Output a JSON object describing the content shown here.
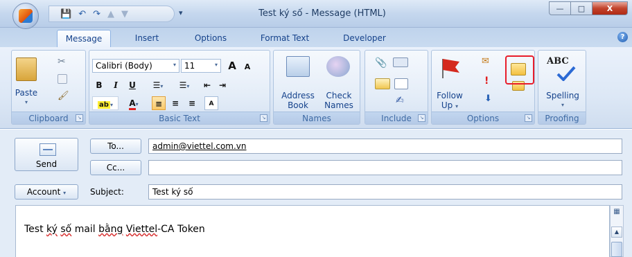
{
  "window": {
    "title": "Test ký số - Message (HTML)",
    "controls": [
      "—",
      "□",
      "X"
    ]
  },
  "qat": {
    "save_icon": "save-icon",
    "undo_icon": "undo-icon",
    "redo_icon": "redo-icon",
    "up_icon": "up-arrow-icon",
    "down_icon": "down-arrow-icon",
    "more": "▾"
  },
  "tabs": [
    "Message",
    "Insert",
    "Options",
    "Format Text",
    "Developer"
  ],
  "help": "?",
  "ribbon": {
    "clipboard": {
      "label": "Clipboard",
      "paste": "Paste"
    },
    "basic_text": {
      "label": "Basic Text",
      "font": "Calibri (Body)",
      "size": "11",
      "grow": "A",
      "shrink": "A",
      "bold": "B",
      "italic": "I",
      "underline": "U"
    },
    "names": {
      "label": "Names",
      "address_book": [
        "Address",
        "Book"
      ],
      "check_names": [
        "Check",
        "Names"
      ]
    },
    "include": {
      "label": "Include"
    },
    "options": {
      "label": "Options",
      "follow_up": [
        "Follow",
        "Up"
      ]
    },
    "proofing": {
      "label": "Proofing",
      "spelling": "Spelling",
      "abc": "ABC"
    }
  },
  "form": {
    "send": "Send",
    "to_button": "To...",
    "cc_button": "Cc...",
    "account_button": "Account",
    "subject_label": "Subject:",
    "to_value": "admin@viettel.com.vn",
    "cc_value": "",
    "subject_value": "Test ký số"
  },
  "body": {
    "text_parts": [
      "Test ",
      "ký",
      " ",
      "số",
      " mail ",
      "bằng",
      " ",
      "Viettel",
      "-CA Token"
    ]
  },
  "colors": {
    "highlight_box": "#e81d2b",
    "ribbon_text": "#15428b"
  }
}
